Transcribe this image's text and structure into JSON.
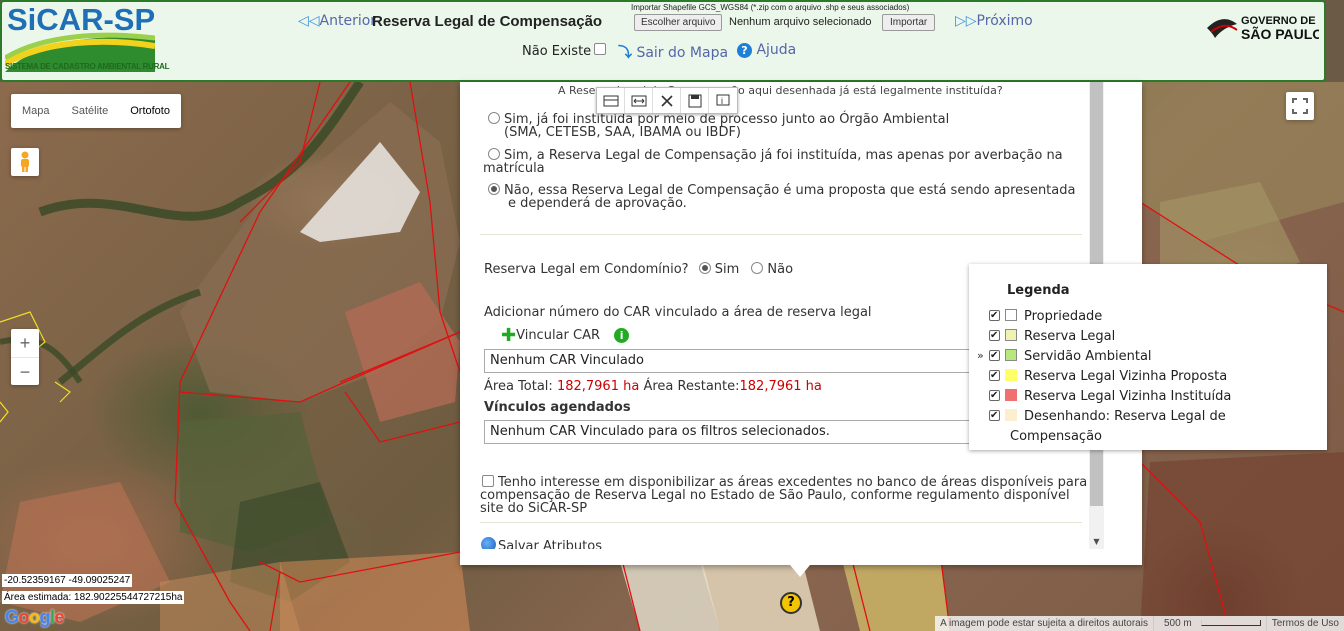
{
  "header": {
    "logo_text": "SiCAR-SP",
    "logo_subtitle": "SISTEMA DE CADASTRO AMBIENTAL RURAL",
    "prev_label": "Anterior",
    "title": "Reserva Legal de Compensação",
    "import_hint": "Importar Shapefile GCS_WGS84 (*.zip com o arquivo .shp e seus associados)",
    "choose_file_label": "Escolher arquivo",
    "no_file_label": "Nenhum arquivo selecionado",
    "import_label": "Importar",
    "next_label": "Próximo",
    "nao_existe_label": "Não Existe",
    "sair_label": "Sair do Mapa",
    "ajuda_label": "Ajuda",
    "gov_line1": "GOVERNO DE",
    "gov_line2": "SÃO PAULO"
  },
  "map": {
    "types": [
      "Mapa",
      "Satélite",
      "Ortofoto"
    ],
    "active_type": "Ortofoto",
    "zoom_in": "+",
    "zoom_out": "−",
    "coords": "-20.52359167 -49.09025247",
    "area_estimada": "Área estimada: 182.90225544727215ha",
    "google_logo": "Google",
    "attribution": "A imagem pode estar sujeita a direitos autorais",
    "scale": "500 m",
    "terms": "Termos de Uso",
    "pin_label": "?"
  },
  "panel": {
    "question": "A Reserva Legal de Compensação aqui desenhada já está legalmente instituída?",
    "options": [
      {
        "line1": "Sim, já foi instituída por meio de processo junto ao Órgão Ambiental",
        "line2": "(SMA, CETESB, SAA, IBAMA ou IBDF)",
        "selected": false
      },
      {
        "line1": "Sim, a Reserva Legal de Compensação já foi instituída, mas apenas por averbação na",
        "line2": "matrícula",
        "selected": false
      },
      {
        "line1": "Não, essa Reserva Legal de Compensação é uma proposta que está sendo apresentada",
        "line2": "e dependerá de aprovação.",
        "selected": true
      }
    ],
    "condominio_label": "Reserva Legal em Condomínio?",
    "condominio_sim": "Sim",
    "condominio_nao": "Não",
    "adicionar_label": "Adicionar número do CAR vinculado a área de reserva legal",
    "vincular_label": "Vincular CAR",
    "vinculado_value": "Nenhum CAR Vinculado",
    "area_total_label": "Área Total:",
    "area_total_value": "182,7961 ha",
    "area_restante_label": "Área Restante:",
    "area_restante_value": "182,7961 ha",
    "vinculos_title": "Vínculos agendados",
    "vinculos_value": "Nenhum CAR Vinculado para os filtros selecionados.",
    "interesse_line1": "Tenho interesse em disponibilizar as áreas excedentes no banco de áreas disponíveis para",
    "interesse_line2": "compensação de Reserva Legal no Estado de São Paulo, conforme regulamento disponível",
    "interesse_line3": "site do SiCAR-SP",
    "salvar_label": "Salvar Atributos"
  },
  "legend": {
    "title": "Legenda",
    "items": [
      {
        "label": "Propriedade",
        "color": "#ffffff"
      },
      {
        "label": "Reserva Legal",
        "color": "#f2f2b0"
      },
      {
        "label": "Servidão Ambiental",
        "color": "#b6e87e"
      },
      {
        "label": "Reserva Legal Vizinha Proposta",
        "color": "#ffff66"
      },
      {
        "label": "Reserva Legal Vizinha Instituída",
        "color": "#f07070"
      },
      {
        "label": "Desenhando: Reserva Legal de",
        "label2": "Compensação",
        "color": "#fbefd0"
      }
    ]
  },
  "colors": {
    "header_bg": "#eaf7ea",
    "header_border": "#2a7a2a",
    "link": "#5566aa",
    "parcel_line": "#e01010",
    "area_value": "#cc0000"
  }
}
